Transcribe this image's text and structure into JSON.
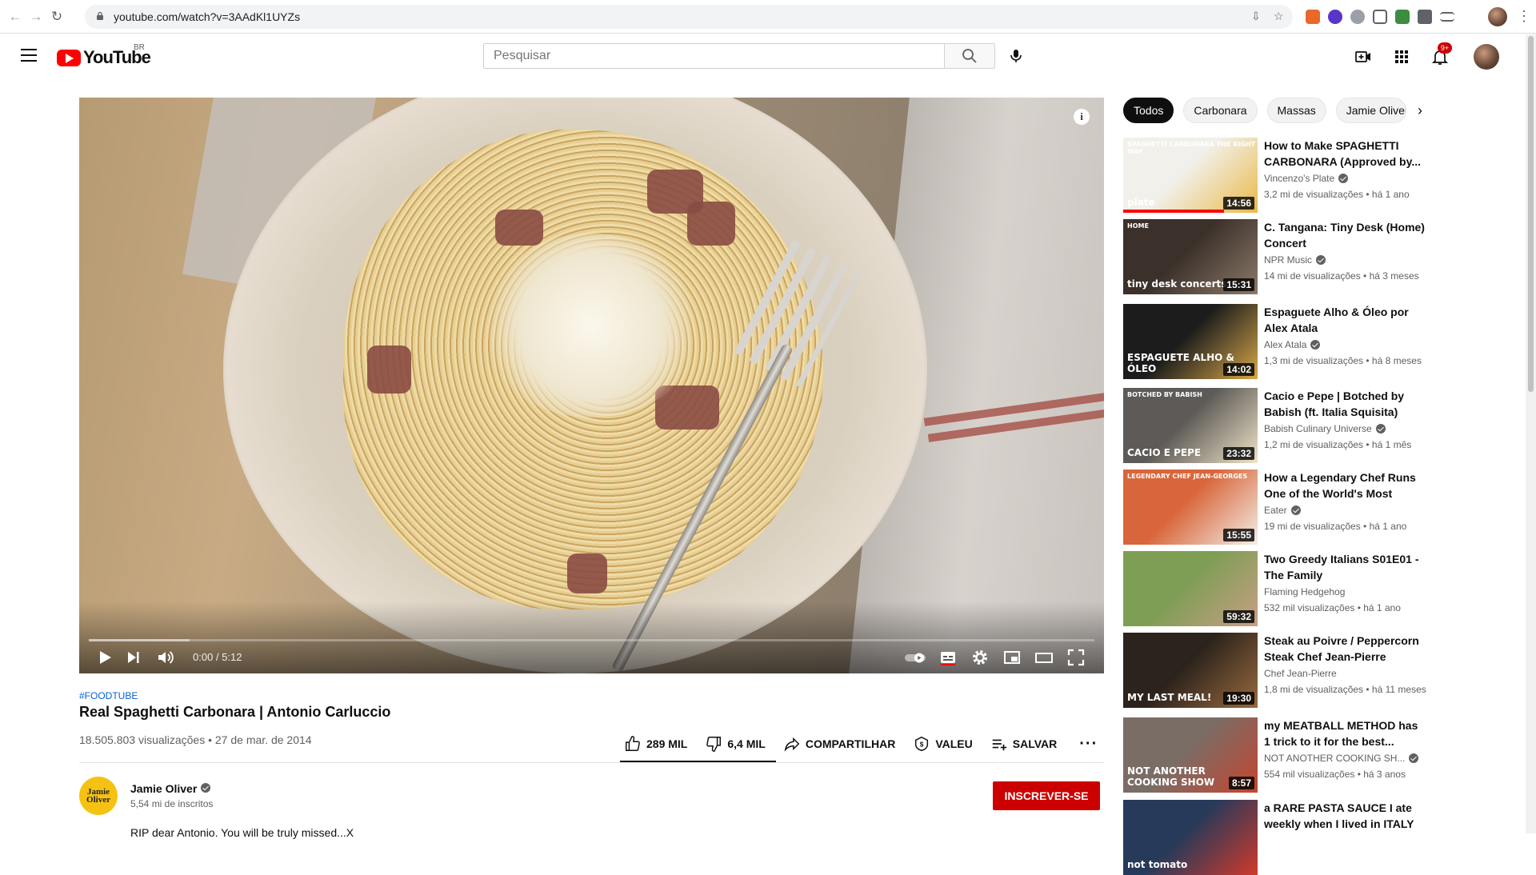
{
  "browser": {
    "url": "youtube.com/watch?v=3AAdKl1UYZs"
  },
  "header": {
    "logo_text": "YouTube",
    "region": "BR",
    "search_placeholder": "Pesquisar",
    "notifications_count": "9+"
  },
  "player": {
    "time": "0:00 / 5:12",
    "progress_fraction": 0.0,
    "buffered_fraction": 0.1
  },
  "video": {
    "hashtag": "#FOODTUBE",
    "title": "Real Spaghetti Carbonara | Antonio Carluccio",
    "stats": "18.505.803 visualizações • 27 de mar. de 2014",
    "likes": "289 MIL",
    "dislikes": "6,4 MIL",
    "share": "COMPARTILHAR",
    "thanks": "VALEU",
    "save": "SALVAR"
  },
  "channel": {
    "name": "Jamie Oliver",
    "avatar_text": "Jamie Oliver",
    "subscribers": "5,54 mi de inscritos",
    "subscribe_label": "INSCREVER-SE",
    "description_preview": "RIP dear Antonio. You will be truly missed...X"
  },
  "chips": [
    "Todos",
    "Carbonara",
    "Massas",
    "Jamie Oliver"
  ],
  "recommendations": [
    {
      "title": "How to Make SPAGHETTI CARBONARA (Approved by...",
      "channel": "Vincenzo's Plate",
      "verified": true,
      "meta": "3,2 mi de visualizações • há 1 ano",
      "duration": "14:56",
      "caption": "plate",
      "caption_small": "SPAGHETTI CARBONARA THE RIGHT WAY",
      "watched_fraction": 0.75,
      "colors": [
        "#f2f0ea",
        "#e9b949"
      ]
    },
    {
      "title": "C. Tangana: Tiny Desk (Home) Concert",
      "channel": "NPR Music",
      "verified": true,
      "meta": "14 mi de visualizações • há 3 meses",
      "duration": "15:31",
      "caption": "tiny desk concerts",
      "caption_small": "HOME",
      "colors": [
        "#3b302a",
        "#8c7a6a"
      ]
    },
    {
      "title": "Espaguete Alho & Óleo por Alex Atala",
      "channel": "Alex Atala",
      "verified": true,
      "meta": "1,3 mi de visualizações • há 8 meses",
      "duration": "14:02",
      "caption": "ESPAGUETE ALHO & ÓLEO",
      "caption_small": "",
      "colors": [
        "#1c1c1c",
        "#d8a84a"
      ]
    },
    {
      "title": "Cacio e Pepe | Botched by Babish (ft. Italia Squisita)",
      "channel": "Babish Culinary Universe",
      "verified": true,
      "meta": "1,2 mi de visualizações • há 1 mês",
      "duration": "23:32",
      "caption": "CACIO E PEPE",
      "caption_small": "BOTCHED BY BABISH",
      "colors": [
        "#5d5a57",
        "#efe4c8"
      ]
    },
    {
      "title": "How a Legendary Chef Runs One of the World's Most Iconi...",
      "channel": "Eater",
      "verified": true,
      "meta": "19 mi de visualizações • há 1 ano",
      "duration": "15:55",
      "caption": "",
      "caption_small": "LEGENDARY CHEF JEAN-GEORGES",
      "colors": [
        "#d9663a",
        "#f3efe9"
      ]
    },
    {
      "title": "Two Greedy Italians S01E01 - The Family",
      "channel": "Flaming Hedgehog",
      "verified": false,
      "meta": "532 mil visualizações • há 1 ano",
      "duration": "59:32",
      "caption": "",
      "caption_small": "",
      "colors": [
        "#7e9e54",
        "#c89f85"
      ]
    },
    {
      "title": "Steak au Poivre / Peppercorn Steak Chef Jean-Pierre",
      "channel": "Chef Jean-Pierre",
      "verified": false,
      "meta": "1,8 mi de visualizações • há 11 meses",
      "duration": "19:30",
      "caption": "MY LAST MEAL!",
      "caption_small": "",
      "colors": [
        "#2b231c",
        "#9a6a3e"
      ]
    },
    {
      "title": "my MEATBALL METHOD has 1 trick to it for the best...",
      "channel": "NOT ANOTHER COOKING SH...",
      "verified": true,
      "meta": "554 mil visualizações • há 3 anos",
      "duration": "8:57",
      "caption": "NOT ANOTHER COOKING SHOW",
      "caption_small": "",
      "colors": [
        "#7a6d66",
        "#c5452f"
      ]
    },
    {
      "title": "a RARE PASTA SAUCE I ate weekly when I lived in ITALY",
      "channel": "",
      "verified": false,
      "meta": "",
      "duration": "",
      "caption": "not tomato",
      "caption_small": "",
      "colors": [
        "#273a5a",
        "#d03a2b"
      ]
    }
  ]
}
